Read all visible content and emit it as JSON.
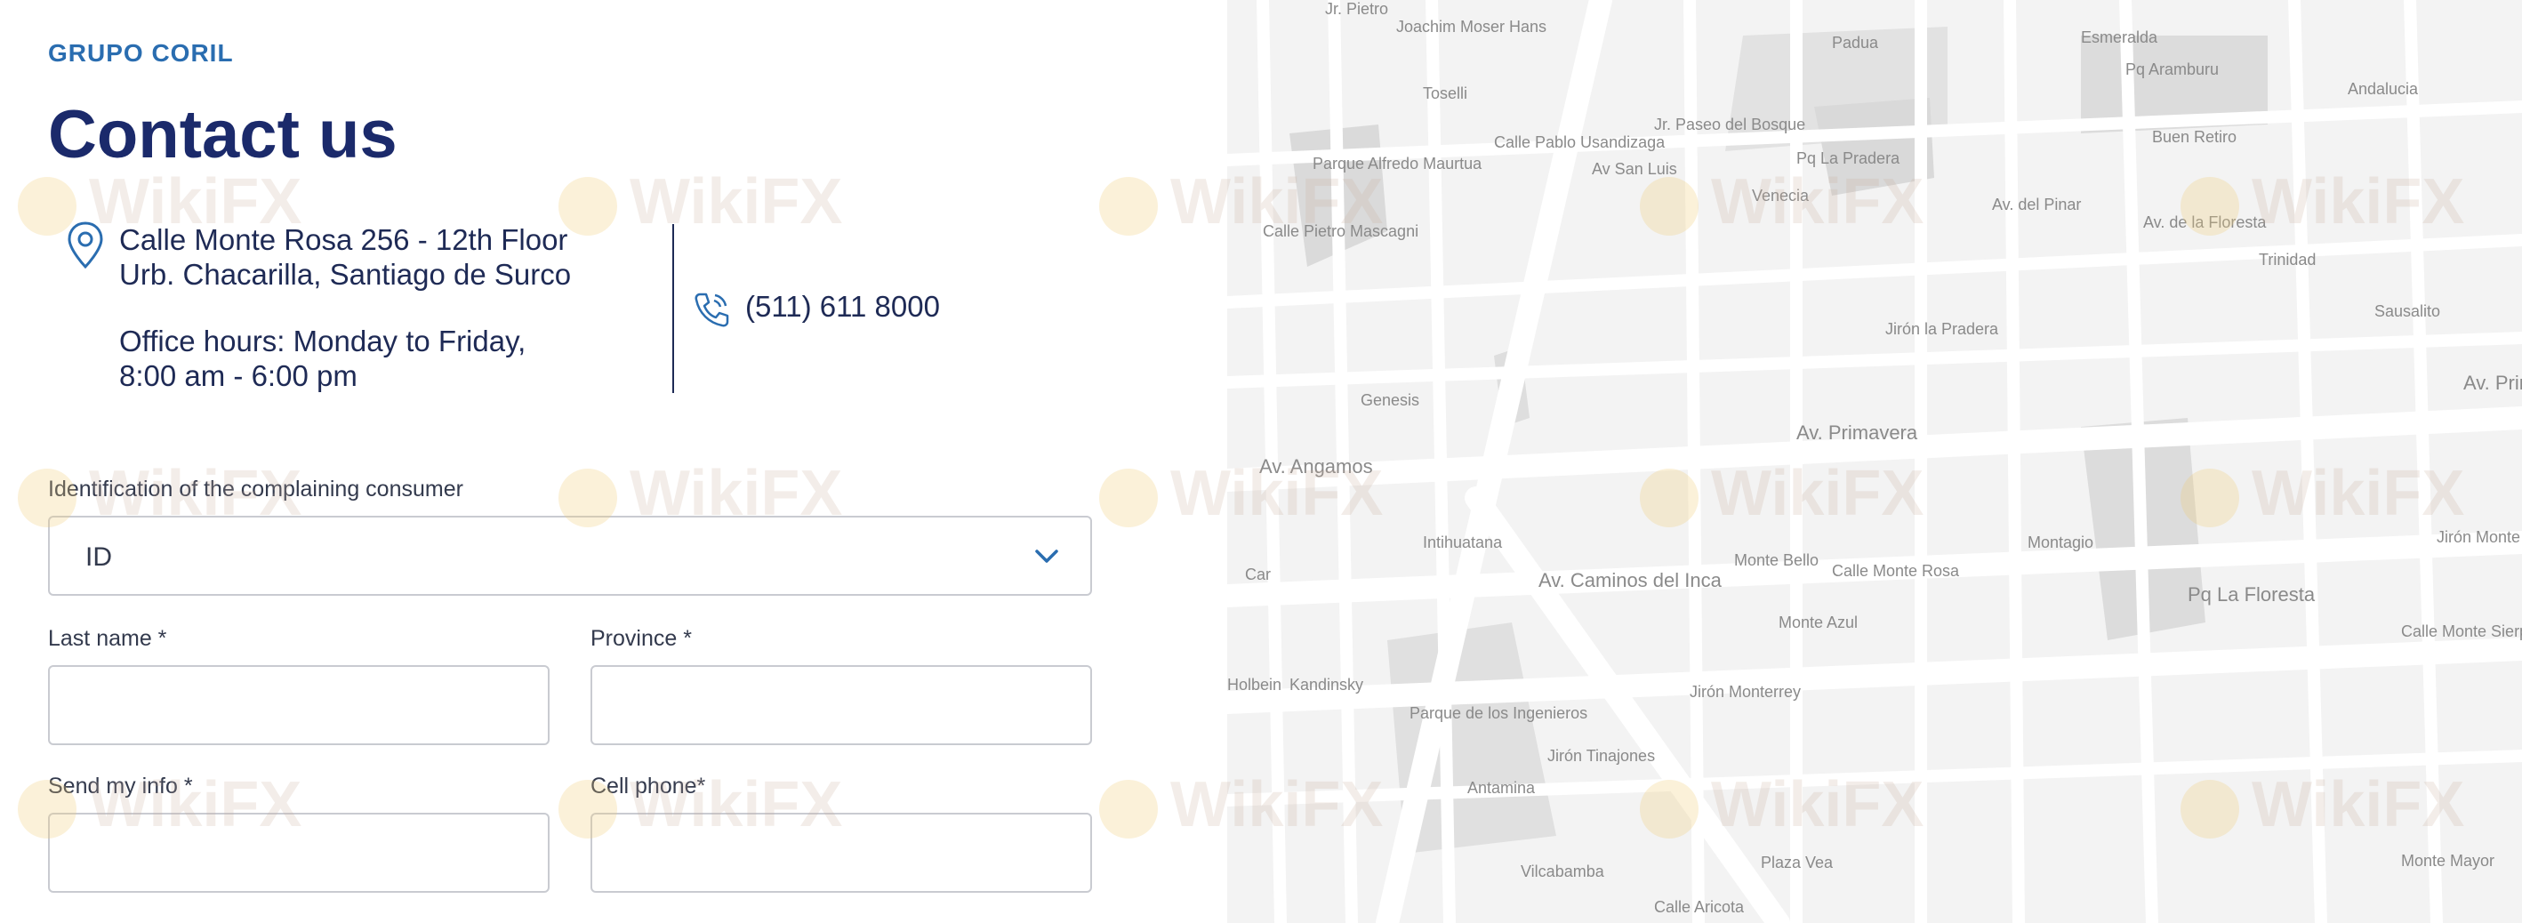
{
  "header": {
    "brand": "GRUPO CORIL",
    "title": "Contact us"
  },
  "contact": {
    "address_line1": "Calle Monte Rosa 256 - 12th Floor",
    "address_line2": "Urb. Chacarilla, Santiago de Surco",
    "hours_line1": "Office hours: Monday to Friday,",
    "hours_line2": "8:00 am - 6:00 pm",
    "phone": "(511) 611 8000",
    "icons": [
      "location-pin-icon",
      "phone-icon"
    ]
  },
  "form": {
    "identification_label": "Identification of the complaining consumer",
    "identification_value": "ID",
    "last_name_label": "Last name *",
    "last_name_value": "",
    "province_label": "Province *",
    "province_value": "",
    "send_info_label": "Send my info *",
    "send_info_value": "",
    "cell_phone_label": "Cell phone*",
    "cell_phone_value": ""
  },
  "watermark": "WikiFX",
  "map": {
    "labels": [
      "Jr. Pietro",
      "Joachim Moser Hans",
      "Toselli",
      "Calle Pablo Usandizaga",
      "Parque Alfredo Maurtua",
      "Calle Pietro Mascagni",
      "Genesis",
      "Av San Luis",
      "Jr. Paseo del Bosque",
      "Venecia",
      "Pq La Pradera",
      "Padua",
      "Jirón la Pradera",
      "Esmeralda",
      "Pq Aramburu",
      "Buen Retiro",
      "Andalucia",
      "Av. del Pinar",
      "Av. de la Floresta",
      "Trinidad",
      "Sausalito",
      "Av. Primavera",
      "Av. Angamos",
      "Av. Caminos del Inca",
      "Intihuatana",
      "Monte Bello",
      "Calle Monte Rosa",
      "Monte Azul",
      "Montagio",
      "Pq La Floresta",
      "Jirón Monterrey",
      "Calle Monte Sierpe",
      "Jirón Monte",
      "Parque de los Ingenieros",
      "Jirón Tinajones",
      "Antamina",
      "Kandinsky",
      "Holbein",
      "Car",
      "Vilcabamba",
      "Plaza Vea",
      "Calle Aricota",
      "Monte Mayor",
      "Av. Prin"
    ]
  }
}
